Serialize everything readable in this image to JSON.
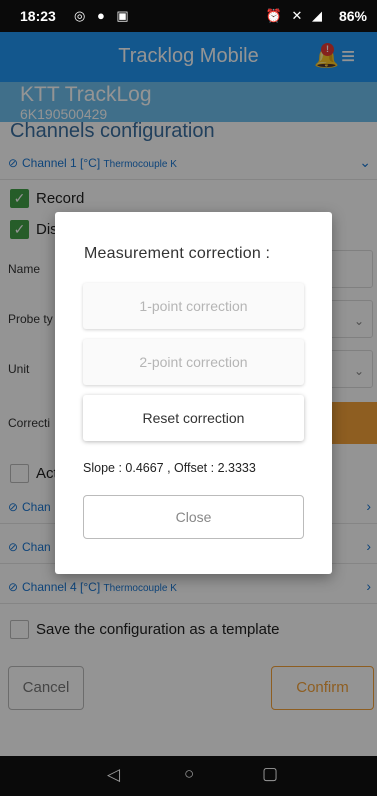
{
  "status_bar": {
    "time": "18:23",
    "left_icons": "◎ ● ▣",
    "right_icons": "⏰ ✕ ◢",
    "battery": "86%"
  },
  "app_bar": {
    "title": "Tracklog Mobile",
    "notification_count": "!",
    "bell_icon": "🔔",
    "menu_icon": "≡"
  },
  "device": {
    "name": "KTT TrackLog",
    "serial": "6K190500429"
  },
  "section_title": "Channels configuration",
  "channels": [
    {
      "label": "Channel 1 [°C]",
      "sub": "Thermocouple K"
    },
    {
      "label": "Chan"
    },
    {
      "label": "Chan"
    },
    {
      "label": "Channel 4 [°C]",
      "sub": "Thermocouple K"
    }
  ],
  "checkboxes": {
    "record": "Record",
    "display": "Dis",
    "active": "Act"
  },
  "fields": {
    "name": "Name",
    "probe_type": "Probe ty",
    "unit": "Unit",
    "correction": "Correcti"
  },
  "save_template": "Save the configuration as a template",
  "buttons": {
    "cancel": "Cancel",
    "confirm": "Confirm"
  },
  "dialog": {
    "title": "Measurement correction :",
    "one_point": "1-point correction",
    "two_point": "2-point correction",
    "reset": "Reset correction",
    "slope_offset": "Slope : 0.4667 , Offset : 2.3333",
    "close": "Close"
  },
  "nav": {
    "back": "◁",
    "home": "○",
    "recent": "▢"
  },
  "colors": {
    "app_bar": "#2196f3",
    "accent": "#f5a23a",
    "check_green": "#43a047",
    "channel_blue": "#1976d2"
  }
}
